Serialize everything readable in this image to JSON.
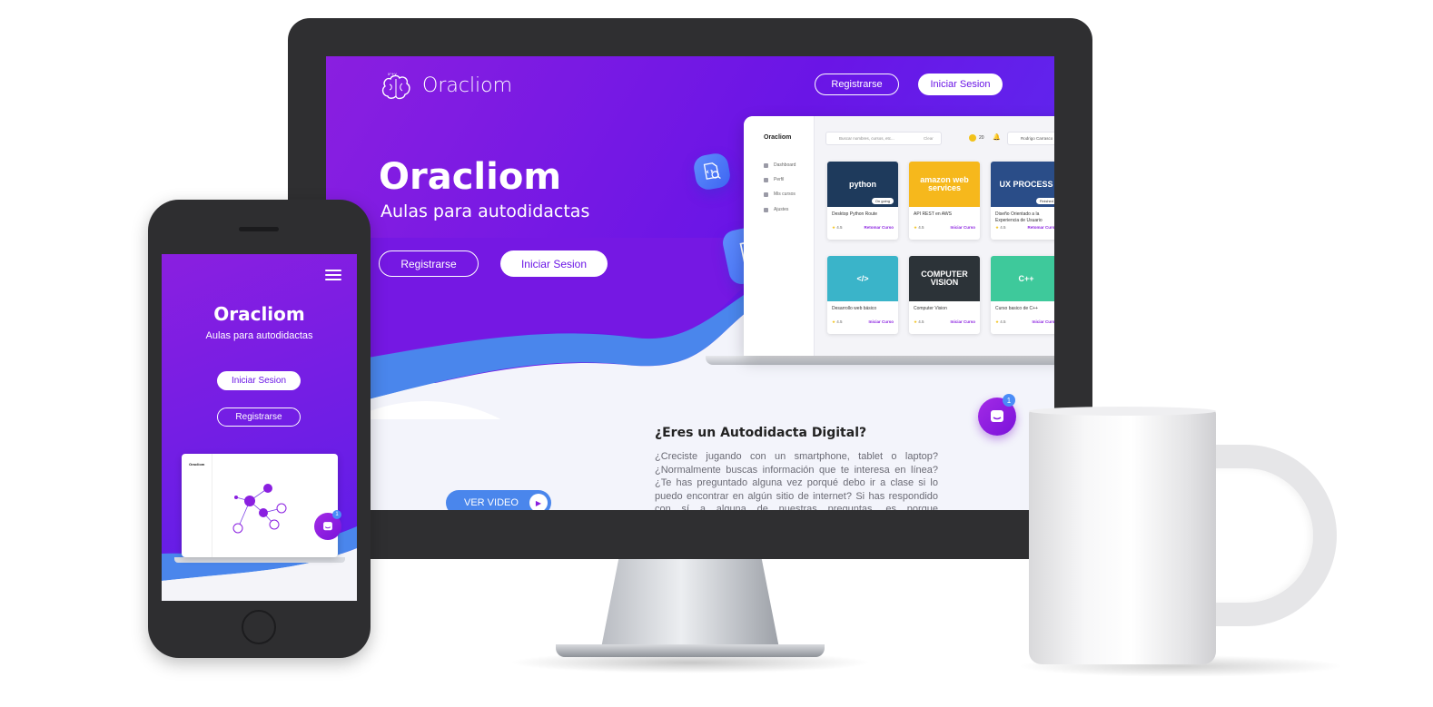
{
  "desktop": {
    "brand": "Oracliom",
    "nav": {
      "register": "Registrarse",
      "login": "Iniciar Sesion"
    },
    "hero": {
      "title": "Oracliom",
      "subtitle": "Aulas para autodidactas",
      "register": "Registrarse",
      "login": "Iniciar Sesion"
    },
    "app_preview": {
      "brand": "Oracliom",
      "search_placeholder": "Buscar nombres, cursos, etc...",
      "search_clear": "Clear",
      "coins": "20",
      "user": "Rodrigo Carrasco",
      "sidebar": [
        "Dashboard",
        "Perfil",
        "Mis cursos",
        "Ajustes"
      ],
      "courses": [
        {
          "title": "Desktop Python Route",
          "rating": "4.5",
          "action": "Retomar Curso",
          "badge": "On going",
          "thumb": "python",
          "color": "#1e3a5c"
        },
        {
          "title": "API REST en AWS",
          "rating": "4.5",
          "action": "Iniciar Curso",
          "badge": "",
          "thumb": "amazon web services",
          "color": "#f6b81c"
        },
        {
          "title": "Diseño Orientado a la Experiencia de Usuario",
          "rating": "4.5",
          "action": "Retomar Curso",
          "badge": "Finished",
          "thumb": "UX PROCESS",
          "color": "#2a4d88"
        },
        {
          "title": "Desarrollo web básico",
          "rating": "4.5",
          "action": "Iniciar Curso",
          "badge": "",
          "thumb": "</>",
          "color": "#3ab4c9"
        },
        {
          "title": "Computer Vision",
          "rating": "4.5",
          "action": "Iniciar Curso",
          "badge": "",
          "thumb": "COMPUTER VISION",
          "color": "#2c3338"
        },
        {
          "title": "Curso basico de C++",
          "rating": "4.5",
          "action": "Iniciar Curso",
          "badge": "",
          "thumb": "C++",
          "color": "#3ec99b"
        }
      ]
    },
    "chat": {
      "count": "1"
    },
    "about": {
      "title": "¿Eres un Autodidacta Digital?",
      "text": "¿Creciste jugando con un smartphone, tablet o laptop? ¿Normalmente buscas información que te interesa en línea? ¿Te has preguntado alguna vez porqué debo ir a clase si lo puedo encontrar en algún sitio de internet? Si has respondido con sí a alguna de nuestras preguntas, es porque definitivamente eres"
    },
    "video_button": "VER VIDEO"
  },
  "mobile": {
    "title": "Oracliom",
    "subtitle": "Aulas para autodidactas",
    "login": "Iniciar Sesion",
    "register": "Registrarse",
    "preview_brand": "Oracliom",
    "chat_count": "1"
  },
  "colors": {
    "primary": "#6a15e6",
    "primary_light": "#8a1fe0",
    "accent_blue": "#4a86ec",
    "star": "#f2c21b"
  }
}
